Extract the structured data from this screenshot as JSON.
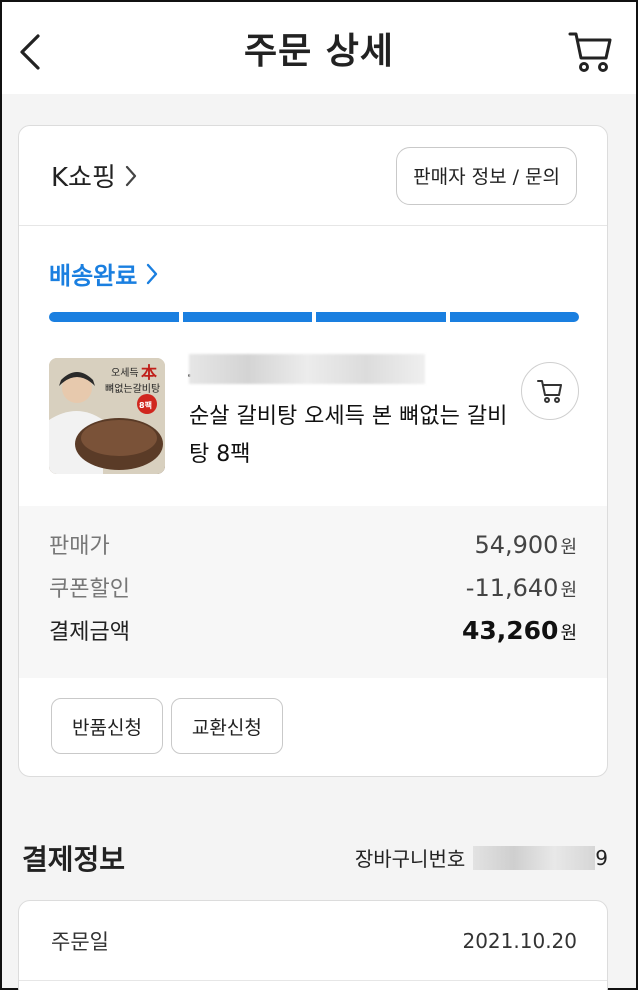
{
  "header": {
    "title": "주문 상세",
    "back_icon": "chevron-left-icon",
    "cart_icon": "cart-icon"
  },
  "seller": {
    "name": "K쇼핑",
    "info_button": "판매자 정보 / 문의"
  },
  "delivery": {
    "status": "배송완료",
    "progress_steps_done": 4,
    "progress_steps_total": 4,
    "accent_color": "#1a7fe0"
  },
  "product": {
    "name": "순살 갈비탕 오세득 본 뼈없는 갈비탕 8팩",
    "thumb_text_top": "오세득",
    "thumb_brand": "本",
    "thumb_subtitle": "뼈없는갈비탕",
    "thumb_badge": "8팩"
  },
  "prices": {
    "sale_label": "판매가",
    "sale_value": "54,900",
    "coupon_label": "쿠폰할인",
    "coupon_value": "-11,640",
    "total_label": "결제금액",
    "total_value": "43,260",
    "unit": "원"
  },
  "actions": {
    "return": "반품신청",
    "exchange": "교환신청"
  },
  "payment": {
    "title": "결제정보",
    "cart_number_label": "장바구니번호",
    "cart_number_suffix": "9"
  },
  "order_info": {
    "date_label": "주문일",
    "date_value": "2021.10.20"
  }
}
